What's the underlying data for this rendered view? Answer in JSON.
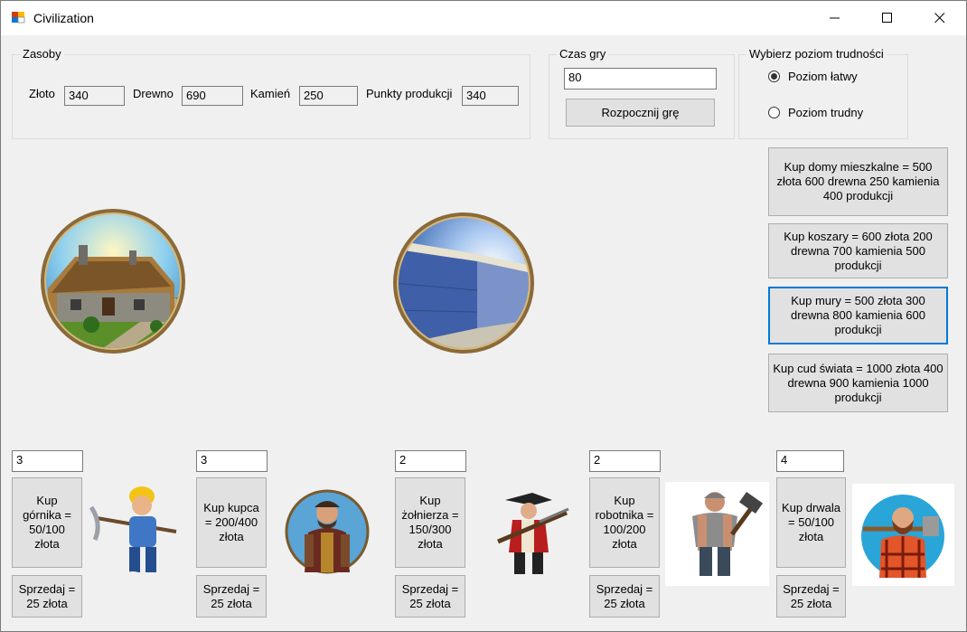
{
  "window": {
    "title": "Civilization"
  },
  "resources": {
    "group_label": "Zasoby",
    "gold_label": "Złoto",
    "gold_value": "340",
    "wood_label": "Drewno",
    "wood_value": "690",
    "stone_label": "Kamień",
    "stone_value": "250",
    "production_label": "Punkty produkcji",
    "production_value": "340"
  },
  "game_time": {
    "group_label": "Czas gry",
    "value": "80",
    "start_button": "Rozpocznij grę"
  },
  "difficulty": {
    "group_label": "Wybierz poziom trudności",
    "options": [
      {
        "label": "Poziom łatwy",
        "selected": true
      },
      {
        "label": "Poziom trudny",
        "selected": false
      }
    ]
  },
  "buildings": [
    {
      "label": "Kup domy mieszkalne = 500 złota 600 drewna 250 kamienia 400 produkcji"
    },
    {
      "label": "Kup koszary = 600 złota 200 drewna 700 kamienia 500 produkcji"
    },
    {
      "label": "Kup mury = 500 złota 300 drewna 800 kamienia 600 produkcji"
    },
    {
      "label": "Kup cud świata = 1000 złota 400 drewna 900 kamienia 1000 produkcji"
    }
  ],
  "units": [
    {
      "count": "3",
      "buy_label": "Kup górnika = 50/100 złota",
      "sell_label": "Sprzedaj = 25 złota"
    },
    {
      "count": "3",
      "buy_label": "Kup kupca = 200/400 złota",
      "sell_label": "Sprzedaj = 25 złota"
    },
    {
      "count": "2",
      "buy_label": "Kup żołnierza = 150/300 złota",
      "sell_label": "Sprzedaj = 25 złota"
    },
    {
      "count": "2",
      "buy_label": "Kup robotnika = 100/200 złota",
      "sell_label": "Sprzedaj = 25 złota"
    },
    {
      "count": "4",
      "buy_label": "Kup drwala = 50/100 złota",
      "sell_label": "Sprzedaj = 25 złota"
    }
  ]
}
